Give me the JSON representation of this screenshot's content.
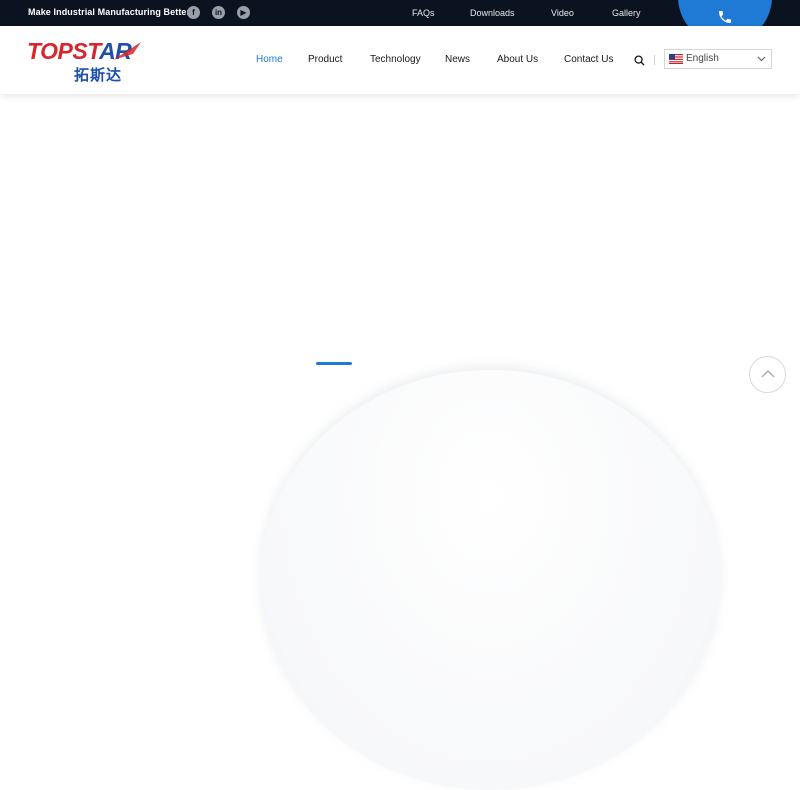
{
  "topbar": {
    "slogan": "Make Industrial Manufacturing Better",
    "social": [
      {
        "icon": "facebook-icon",
        "glyph": "f"
      },
      {
        "icon": "linkedin-icon",
        "glyph": "in"
      },
      {
        "icon": "youtube-icon",
        "glyph": "▶"
      }
    ],
    "links": [
      "FAQs",
      "Downloads",
      "Video",
      "Gallery"
    ]
  },
  "logo": {
    "text_en_main": "TOPST",
    "text_en_tail": "AR",
    "text_cn": "拓斯达"
  },
  "nav": {
    "items": [
      "Home",
      "Product",
      "Technology",
      "News",
      "About Us",
      "Contact Us"
    ],
    "active": "Home"
  },
  "language": {
    "selected": "English",
    "flag": "us-flag-icon"
  },
  "colors": {
    "accent": "#1f7ad6",
    "topbar_bg": "#0c1320",
    "logo_red": "#d8262e",
    "logo_blue": "#1e4fa8"
  },
  "icons": {
    "phone": "phone-icon",
    "search": "search-icon",
    "back_to_top": "chevron-up-icon",
    "dropdown": "chevron-down-icon"
  }
}
